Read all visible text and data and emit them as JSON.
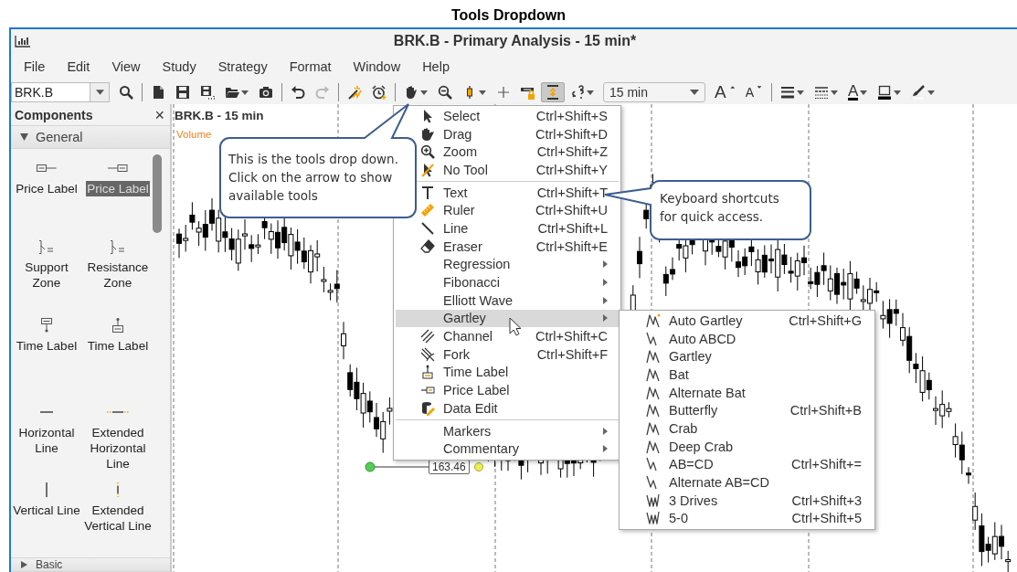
{
  "heading": "Tools Dropdown",
  "window": {
    "title": "BRK.B - Primary Analysis - 15 min*"
  },
  "menu_bar": [
    "File",
    "Edit",
    "View",
    "Study",
    "Strategy",
    "Format",
    "Window",
    "Help"
  ],
  "toolbar": [
    {
      "kind": "symbol_field",
      "value": "BRK.B"
    },
    {
      "kind": "button",
      "dropdown": false,
      "pressed": false,
      "disabled": false
    },
    {
      "kind": "separator"
    },
    {
      "kind": "button",
      "dropdown": false,
      "pressed": false,
      "disabled": false
    },
    {
      "kind": "button",
      "dropdown": false,
      "pressed": false,
      "disabled": false
    },
    {
      "kind": "button",
      "dropdown": false,
      "pressed": false,
      "disabled": false
    },
    {
      "kind": "button",
      "dropdown": true,
      "pressed": false,
      "disabled": false
    },
    {
      "kind": "button",
      "dropdown": false,
      "pressed": false,
      "disabled": false
    },
    {
      "kind": "separator"
    },
    {
      "kind": "button",
      "dropdown": false,
      "pressed": false,
      "disabled": false
    },
    {
      "kind": "button",
      "dropdown": false,
      "pressed": false,
      "disabled": true
    },
    {
      "kind": "separator"
    },
    {
      "kind": "button",
      "dropdown": false,
      "pressed": false,
      "disabled": false
    },
    {
      "kind": "button",
      "dropdown": false,
      "pressed": false,
      "disabled": false
    },
    {
      "kind": "separator"
    },
    {
      "kind": "button",
      "dropdown": true,
      "pressed": false,
      "disabled": false
    },
    {
      "kind": "button",
      "dropdown": false,
      "pressed": false,
      "disabled": false
    },
    {
      "kind": "button",
      "dropdown": true,
      "pressed": false,
      "disabled": false
    },
    {
      "kind": "button",
      "dropdown": false,
      "pressed": false,
      "disabled": false
    },
    {
      "kind": "button",
      "dropdown": false,
      "pressed": false,
      "disabled": false
    },
    {
      "kind": "button",
      "dropdown": false,
      "pressed": true,
      "disabled": false
    },
    {
      "kind": "button",
      "dropdown": true,
      "pressed": false,
      "disabled": false
    },
    {
      "kind": "interval_field",
      "value": "15 min"
    },
    {
      "kind": "button",
      "text": "A",
      "dropdown": false,
      "pressed": false,
      "disabled": false
    },
    {
      "kind": "button",
      "text": "A",
      "dropdown": false,
      "pressed": false,
      "disabled": false
    },
    {
      "kind": "separator"
    },
    {
      "kind": "button",
      "dropdown": true,
      "pressed": false,
      "disabled": false
    },
    {
      "kind": "button",
      "dropdown": true,
      "pressed": false,
      "disabled": false
    },
    {
      "kind": "button",
      "text": "A",
      "dropdown": true,
      "pressed": false,
      "disabled": false
    },
    {
      "kind": "button",
      "dropdown": true,
      "pressed": false,
      "disabled": false
    },
    {
      "kind": "button",
      "dropdown": true,
      "pressed": false,
      "disabled": false
    }
  ],
  "components_panel": {
    "title": "Components",
    "close": "×",
    "sections": [
      {
        "label": "General",
        "expanded": true,
        "items": [
          {
            "label": "Price Label",
            "selected": false
          },
          {
            "label": "Price Label",
            "selected": true
          },
          {
            "label": "Support Zone",
            "selected": false
          },
          {
            "label": "Resistance Zone",
            "selected": false
          },
          {
            "label": "Time Label",
            "selected": false
          },
          {
            "label": "Time Label",
            "selected": false
          },
          {
            "label": "Horizontal Line",
            "selected": false
          },
          {
            "label": "Extended Horizontal Line",
            "selected": false
          },
          {
            "label": "Vertical Line",
            "selected": false
          },
          {
            "label": "Extended Vertical Line",
            "selected": false
          }
        ]
      },
      {
        "label": "Basic",
        "expanded": false
      }
    ]
  },
  "chart": {
    "title": "BRK.B - 15 min",
    "study_label": "Volume",
    "price_label": "163.46"
  },
  "tools_menu": {
    "items": [
      {
        "kind": "item",
        "label": "Select",
        "shortcut": "Ctrl+Shift+S",
        "submenu": false,
        "selected": false
      },
      {
        "kind": "item",
        "label": "Drag",
        "shortcut": "Ctrl+Shift+D",
        "submenu": false,
        "selected": false
      },
      {
        "kind": "item",
        "label": "Zoom",
        "shortcut": "Ctrl+Shift+Z",
        "submenu": false,
        "selected": false
      },
      {
        "kind": "item",
        "label": "No Tool",
        "shortcut": "Ctrl+Shift+Y",
        "submenu": false,
        "selected": false
      },
      {
        "kind": "separator"
      },
      {
        "kind": "item",
        "label": "Text",
        "shortcut": "Ctrl+Shift+T",
        "submenu": false,
        "selected": false
      },
      {
        "kind": "item",
        "label": "Ruler",
        "shortcut": "Ctrl+Shift+U",
        "submenu": false,
        "selected": false
      },
      {
        "kind": "item",
        "label": "Line",
        "shortcut": "Ctrl+Shift+L",
        "submenu": false,
        "selected": false
      },
      {
        "kind": "item",
        "label": "Eraser",
        "shortcut": "Ctrl+Shift+E",
        "submenu": false,
        "selected": false
      },
      {
        "kind": "item",
        "label": "Regression",
        "submenu": true,
        "selected": false
      },
      {
        "kind": "item",
        "label": "Fibonacci",
        "submenu": true,
        "selected": false
      },
      {
        "kind": "item",
        "label": "Elliott Wave",
        "submenu": true,
        "selected": false
      },
      {
        "kind": "item",
        "label": "Gartley",
        "submenu": true,
        "selected": true
      },
      {
        "kind": "item",
        "label": "Channel",
        "shortcut": "Ctrl+Shift+C",
        "submenu": false,
        "selected": false
      },
      {
        "kind": "item",
        "label": "Fork",
        "shortcut": "Ctrl+Shift+F",
        "submenu": false,
        "selected": false
      },
      {
        "kind": "item",
        "label": "Time Label",
        "submenu": false,
        "selected": false
      },
      {
        "kind": "item",
        "label": "Price Label",
        "submenu": false,
        "selected": false
      },
      {
        "kind": "item",
        "label": "Data Edit",
        "submenu": false,
        "selected": false
      },
      {
        "kind": "separator"
      },
      {
        "kind": "item",
        "label": "Markers",
        "submenu": true,
        "selected": false
      },
      {
        "kind": "item",
        "label": "Commentary",
        "submenu": true,
        "selected": false
      }
    ]
  },
  "gartley_submenu": {
    "items": [
      {
        "label": "Auto Gartley",
        "shortcut": "Ctrl+Shift+G"
      },
      {
        "label": "Auto ABCD"
      },
      {
        "label": "Gartley"
      },
      {
        "label": "Bat"
      },
      {
        "label": "Alternate Bat"
      },
      {
        "label": "Butterfly",
        "shortcut": "Ctrl+Shift+B"
      },
      {
        "label": "Crab"
      },
      {
        "label": "Deep Crab"
      },
      {
        "label": "AB=CD",
        "shortcut": "Ctrl+Shift+="
      },
      {
        "label": "Alternate AB=CD"
      },
      {
        "label": "3 Drives",
        "shortcut": "Ctrl+Shift+3"
      },
      {
        "label": "5-0",
        "shortcut": "Ctrl+Shift+5"
      }
    ]
  },
  "callouts": [
    {
      "text": "This is the tools drop down.  Click on the arrow to show available tools"
    },
    {
      "text": "Keyboard shortcuts for quick access."
    }
  ]
}
